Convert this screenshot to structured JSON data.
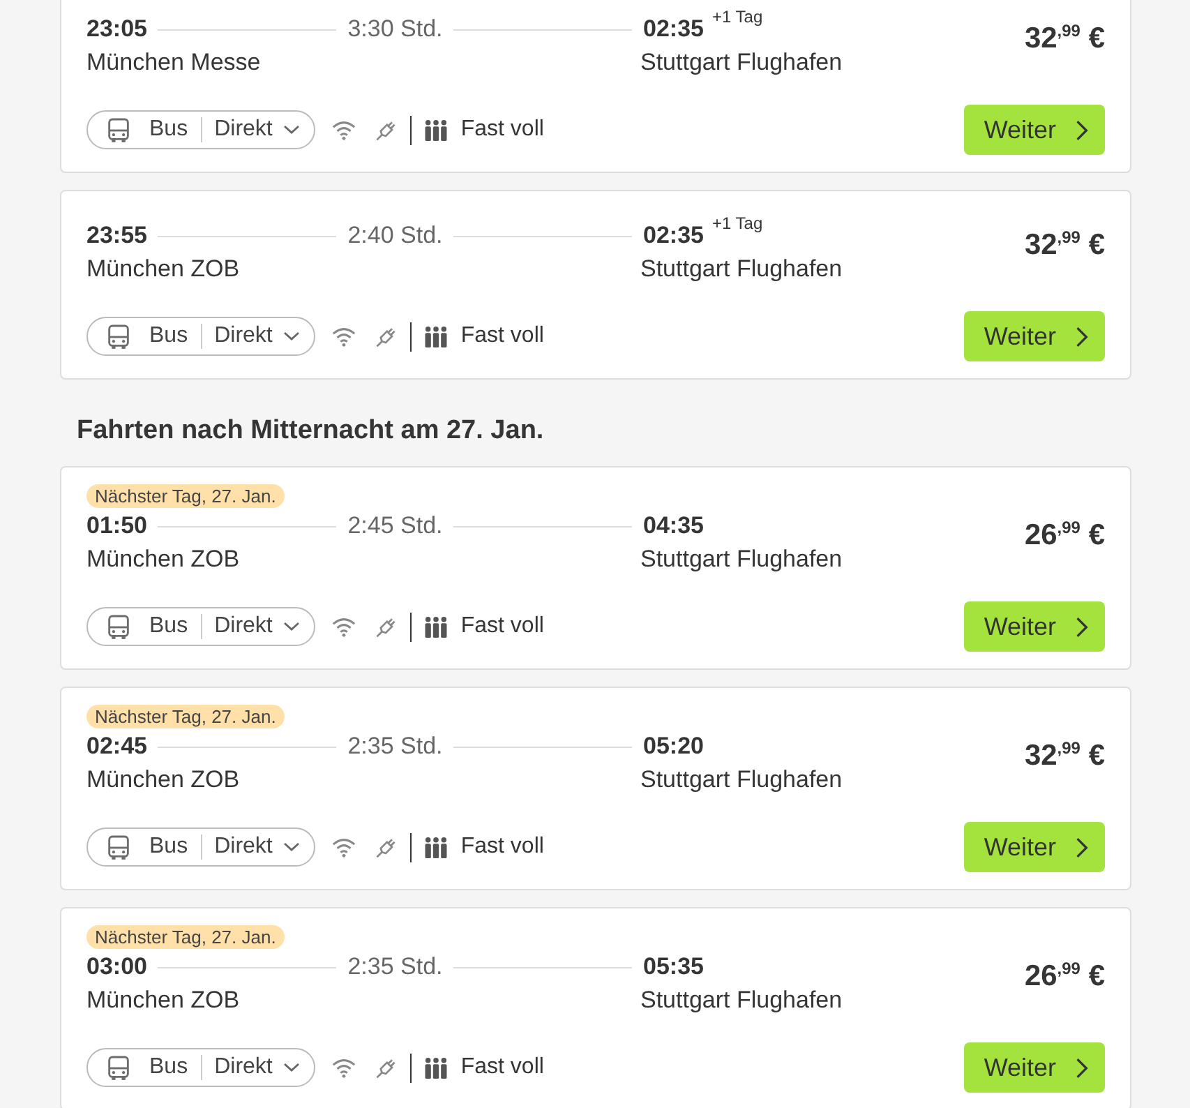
{
  "sections": [
    {
      "trips": [
        {
          "dep_time": "23:05",
          "duration": "3:30 Std.",
          "arr_time": "02:35",
          "arr_note": "+1 Tag",
          "from": "München Messe",
          "to": "Stuttgart Flughafen",
          "price": "32$^{,99}$ €",
          "mode": "Bus",
          "route": "Direkt",
          "occupancy": "Fast voll",
          "button": "Weiter"
        },
        {
          "dep_time": "23:55",
          "duration": "2:40 Std.",
          "arr_time": "02:35",
          "arr_note": "+1 Tag",
          "from": "München ZOB",
          "to": "Stuttgart Flughafen",
          "price": "32$^{,99}$ €",
          "mode": "Bus",
          "route": "Direkt",
          "occupancy": "Fast voll",
          "button": "Weiter"
        }
      ]
    },
    {
      "heading": "Fahrten nach Mitternacht am 27. Jan.",
      "trips": [
        {
          "badge": "Nächster Tag, 27. Jan.",
          "dep_time": "01:50",
          "duration": "2:45 Std.",
          "arr_time": "04:35",
          "from": "München ZOB",
          "to": "Stuttgart Flughafen",
          "price": "26$^{,99}$ €",
          "mode": "Bus",
          "route": "Direkt",
          "occupancy": "Fast voll",
          "button": "Weiter"
        },
        {
          "badge": "Nächster Tag, 27. Jan.",
          "dep_time": "02:45",
          "duration": "2:35 Std.",
          "arr_time": "05:20",
          "from": "München ZOB",
          "to": "Stuttgart Flughafen",
          "price": "32$^{,99}$ €",
          "mode": "Bus",
          "route": "Direkt",
          "occupancy": "Fast voll",
          "button": "Weiter"
        },
        {
          "badge": "Nächster Tag, 27. Jan.",
          "dep_time": "03:00",
          "duration": "2:35 Std.",
          "arr_time": "05:35",
          "from": "München ZOB",
          "to": "Stuttgart Flughafen",
          "price": "26$^{,99}$ €",
          "mode": "Bus",
          "route": "Direkt",
          "occupancy": "Fast voll",
          "button": "Weiter"
        }
      ]
    }
  ]
}
